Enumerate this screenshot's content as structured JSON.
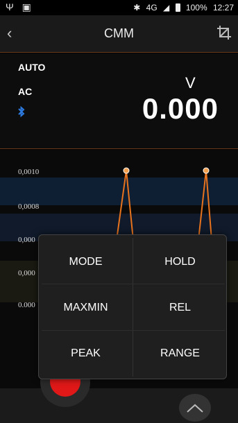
{
  "status_bar": {
    "left_icons": [
      "usb-icon",
      "image-icon"
    ],
    "network": "4G",
    "battery": "100%",
    "time": "12:27"
  },
  "app_bar": {
    "back_glyph": "‹",
    "title": "CMM"
  },
  "readout": {
    "mode": "AUTO",
    "ac_dc": "AC",
    "unit": "V",
    "value": "0.000",
    "bluetooth_glyph": "ʙ"
  },
  "graph": {
    "y_labels": [
      "0,0010",
      "0,0008",
      "0,000",
      "0,000",
      "0.000"
    ]
  },
  "menu": {
    "items": [
      "MODE",
      "HOLD",
      "MAXMIN",
      "REL",
      "PEAK",
      "RANGE"
    ]
  },
  "colors": {
    "accent": "#e8731e",
    "record": "#e01818"
  }
}
